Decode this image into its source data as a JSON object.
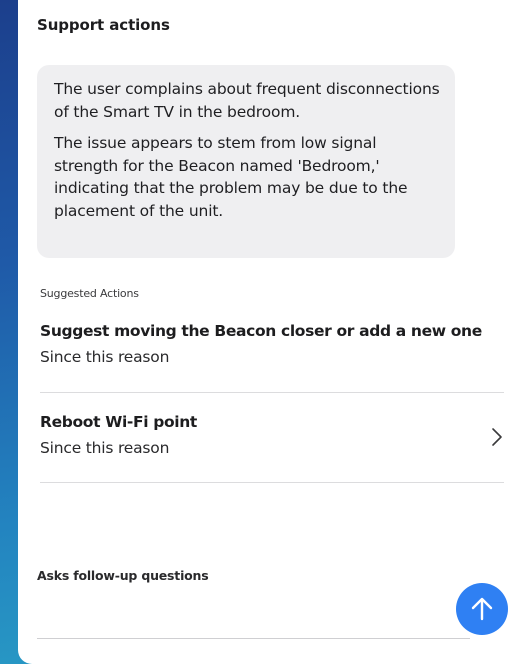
{
  "panel": {
    "title": "Support actions"
  },
  "summary": {
    "paragraphs": [
      "The user complains about frequent disconnections of the Smart TV in the bedroom.",
      "The issue appears to stem from low signal strength for the Beacon named 'Bedroom,' indicating that the problem may be due to the placement of the unit."
    ]
  },
  "suggested": {
    "label": "Suggested Actions",
    "actions": [
      {
        "title": "Suggest moving the Beacon closer or add a new one",
        "subtitle": "Since this reason"
      },
      {
        "title": "Reboot Wi-Fi point",
        "subtitle": "Since this reason",
        "icon": "chevron-right-icon"
      }
    ]
  },
  "followup": {
    "label": "Asks follow-up questions",
    "value": "",
    "placeholder": ""
  },
  "send": {
    "icon": "arrow-up-icon",
    "color": "#2f80f3"
  },
  "colors": {
    "background_top": "#1c3f8c",
    "background_bottom": "#2aa2c6",
    "bubble": "#efeff1"
  }
}
